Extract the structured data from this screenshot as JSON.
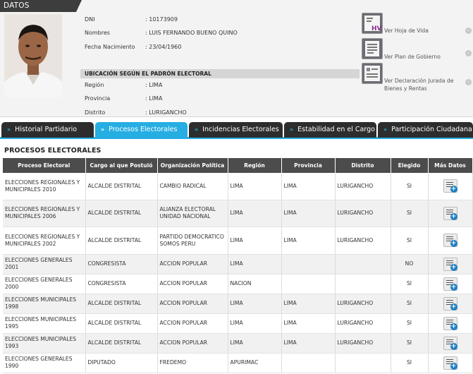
{
  "header": {
    "title": "DATOS GENERALES"
  },
  "person": {
    "fields": [
      {
        "label": "DNI",
        "value": ": 10173909"
      },
      {
        "label": "Nombres",
        "value": ": LUIS FERNANDO BUENO QUINO"
      },
      {
        "label": "Fecha Nacimiento",
        "value": ": 23/04/1960"
      }
    ],
    "ubicacion_title": "UBICACIÓN SEGÚN EL PADRÓN ELECTORAL",
    "ubicacion": [
      {
        "label": "Región",
        "value": ": LIMA"
      },
      {
        "label": "Provincia",
        "value": ": LIMA"
      },
      {
        "label": "Distrito",
        "value": ": LURIGANCHO"
      }
    ]
  },
  "links": [
    {
      "icon": "hoja-de-vida-icon",
      "label": "Ver Hoja de Vida"
    },
    {
      "icon": "plan-gobierno-icon",
      "label": "Ver Plan de Gobierno"
    },
    {
      "icon": "declaracion-jurada-icon",
      "label": "Ver Declaración Jurada de Bienes y Rentas"
    }
  ],
  "tabs": [
    {
      "label": "Historial Partidario",
      "active": false
    },
    {
      "label": "Procesos Electorales",
      "active": true
    },
    {
      "label": "Incidencias Electorales",
      "active": false
    },
    {
      "label": "Estabilidad en el Cargo",
      "active": false
    },
    {
      "label": "Participación Ciudadana",
      "active": false
    }
  ],
  "section": {
    "title": "PROCESOS ELECTORALES"
  },
  "table": {
    "headers": [
      "Proceso Electoral",
      "Cargo al que Postuló",
      "Organización Política",
      "Región",
      "Provincia",
      "Distrito",
      "Elegido",
      "Más Datos"
    ],
    "rows": [
      [
        "ELECCIONES REGIONALES Y MUNICIPALES 2010",
        "ALCALDE DISTRITAL",
        "CAMBIO RADICAL",
        "LIMA",
        "LIMA",
        "LURIGANCHO",
        "SI"
      ],
      [
        "ELECCIONES REGIONALES Y MUNICIPALES 2006",
        "ALCALDE DISTRITAL",
        "ALIANZA ELECTORAL UNIDAD NACIONAL",
        "LIMA",
        "LIMA",
        "LURIGANCHO",
        "SI"
      ],
      [
        "ELECCIONES REGIONALES Y MUNICIPALES 2002",
        "ALCALDE DISTRITAL",
        "PARTIDO DEMOCRATICO SOMOS PERU",
        "LIMA",
        "LIMA",
        "LURIGANCHO",
        "SI"
      ],
      [
        "ELECCIONES GENERALES 2001",
        "CONGRESISTA",
        "ACCION POPULAR",
        "LIMA",
        "",
        "",
        "NO"
      ],
      [
        "ELECCIONES GENERALES 2000",
        "CONGRESISTA",
        "ACCION POPULAR",
        "NACION",
        "",
        "",
        "SI"
      ],
      [
        "ELECCIONES MUNICIPALES 1998",
        "ALCALDE DISTRITAL",
        "ACCION POPULAR",
        "LIMA",
        "LIMA",
        "LURIGANCHO",
        "SI"
      ],
      [
        "ELECCIONES MUNICIPALES 1995",
        "ALCALDE DISTRITAL",
        "ACCION POPULAR",
        "LIMA",
        "LIMA",
        "LURIGANCHO",
        "SI"
      ],
      [
        "ELECCIONES MUNICIPALES 1993",
        "ALCALDE DISTRITAL",
        "ACCION POPULAR",
        "LIMA",
        "LIMA",
        "LURIGANCHO",
        "SI"
      ],
      [
        "ELECCIONES GENERALES 1990",
        "DIPUTADO",
        "FREDEMO",
        "APURIMAC",
        "",
        "",
        "SI"
      ]
    ]
  },
  "colors": {
    "accent": "#26aee3",
    "dark": "#2d2d2d",
    "header": "#4c4c4c"
  }
}
